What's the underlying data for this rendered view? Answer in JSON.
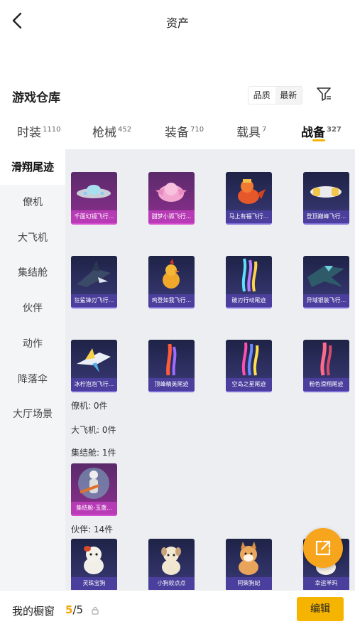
{
  "header": {
    "title": "资产"
  },
  "warehouse": {
    "title": "游戏仓库"
  },
  "sort": {
    "options": [
      "品质",
      "最新"
    ],
    "active": 0
  },
  "tabs": [
    {
      "label": "时装",
      "count": "1110"
    },
    {
      "label": "枪械",
      "count": "452"
    },
    {
      "label": "装备",
      "count": "710"
    },
    {
      "label": "载具",
      "count": "7"
    },
    {
      "label": "战备",
      "count": "327"
    }
  ],
  "active_tab": 4,
  "sidebar": {
    "items": [
      "滑翔尾迹",
      "僚机",
      "大飞机",
      "集结舱",
      "伙伴",
      "动作",
      "降落伞",
      "大厅场景"
    ]
  },
  "items": [
    {
      "label": "千面幻镜飞行...",
      "style": "pink",
      "icon": "silver-ufo-glider-icon"
    },
    {
      "label": "甜梦小狐飞行...",
      "style": "pink",
      "icon": "pink-fox-glider-icon"
    },
    {
      "label": "马上有福飞行...",
      "style": "blue",
      "icon": "horse-glider-icon"
    },
    {
      "label": "登顶巅峰飞行...",
      "style": "blue",
      "icon": "white-jet-glider-icon"
    },
    {
      "label": "狂鲨锋刃飞行...",
      "style": "blue",
      "icon": "shark-glider-icon"
    },
    {
      "label": "鸡登如我飞行...",
      "style": "blue",
      "icon": "chicken-glider-icon"
    },
    {
      "label": "破刃行动尾迹",
      "style": "blue",
      "icon": "rainbow-trail-icon"
    },
    {
      "label": "异域银装飞行...",
      "style": "blue",
      "icon": "dragon-glider-icon"
    },
    {
      "label": "冰柠泡泡飞行...",
      "style": "blue",
      "icon": "lemon-jet-glider-icon"
    },
    {
      "label": "顶峰精英尾迹",
      "style": "blue",
      "icon": "flame-trail-icon"
    },
    {
      "label": "空岛之星尾迹",
      "style": "blue",
      "icon": "star-trail-icon"
    },
    {
      "label": "粉色滑翔尾迹",
      "style": "blue",
      "icon": "pink-trail-icon"
    }
  ],
  "sections": {
    "wingman": "僚机: 0件",
    "big_plane": "大飞机: 0件",
    "pod": "集结舱: 1件",
    "partner": "伙伴: 14件"
  },
  "pod_item": {
    "label": "集结舱-玉盏...",
    "icon": "pod-figure-icon"
  },
  "partners": [
    {
      "label": "灵珠宝狗",
      "icon": "dog-partner-icon"
    },
    {
      "label": "小狗软点点",
      "icon": "cream-dog-partner-icon"
    },
    {
      "label": "阿柴狗妃",
      "icon": "shiba-partner-icon"
    },
    {
      "label": "幸运羊玛",
      "icon": "sheep-partner-icon"
    }
  ],
  "bottom": {
    "label": "我的橱窗",
    "count_current": "5",
    "count_total": "/5",
    "edit": "编辑"
  },
  "colors": {
    "accent": "#f5b400",
    "fab": "#f7a51c"
  }
}
